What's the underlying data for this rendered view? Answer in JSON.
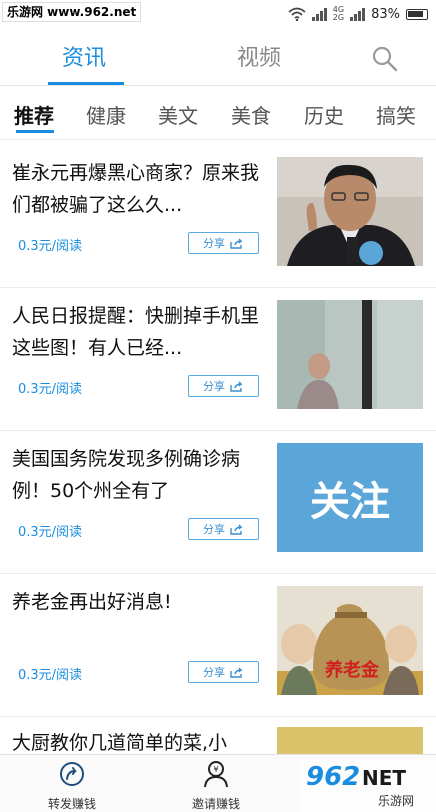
{
  "status_bar": {
    "watermark": "乐游网 www.962.net",
    "network": "4G",
    "network2": "2G",
    "battery": "83%"
  },
  "header": {
    "tab_news": "资讯",
    "tab_video": "视频"
  },
  "categories": [
    "推荐",
    "健康",
    "美文",
    "美食",
    "历史",
    "搞笑"
  ],
  "articles": [
    {
      "title": "崔永元再爆黑心商家？原来我们都被骗了这么久...",
      "price": "0.3元/阅读",
      "share": "分享"
    },
    {
      "title": "人民日报提醒：快删掉手机里这些图！有人已经...",
      "price": "0.3元/阅读",
      "share": "分享"
    },
    {
      "title": "美国国务院发现多例确诊病例！50个州全有了",
      "price": "0.3元/阅读",
      "share": "分享",
      "thumb_text": "关注"
    },
    {
      "title": "养老金再出好消息!",
      "price": "0.3元/阅读",
      "share": "分享",
      "thumb_text": "养老金"
    },
    {
      "title": "大厨教你几道简单的菜,小",
      "price": "",
      "share": ""
    }
  ],
  "bottom_nav": {
    "repost": "转发赚钱",
    "invite": "邀请赚钱"
  },
  "bottom_watermark": {
    "brand": "962",
    "net": "NET",
    "sub": "乐游网"
  },
  "colors": {
    "accent": "#1a8de0",
    "thumb_follow_bg": "#5aa6d8"
  }
}
